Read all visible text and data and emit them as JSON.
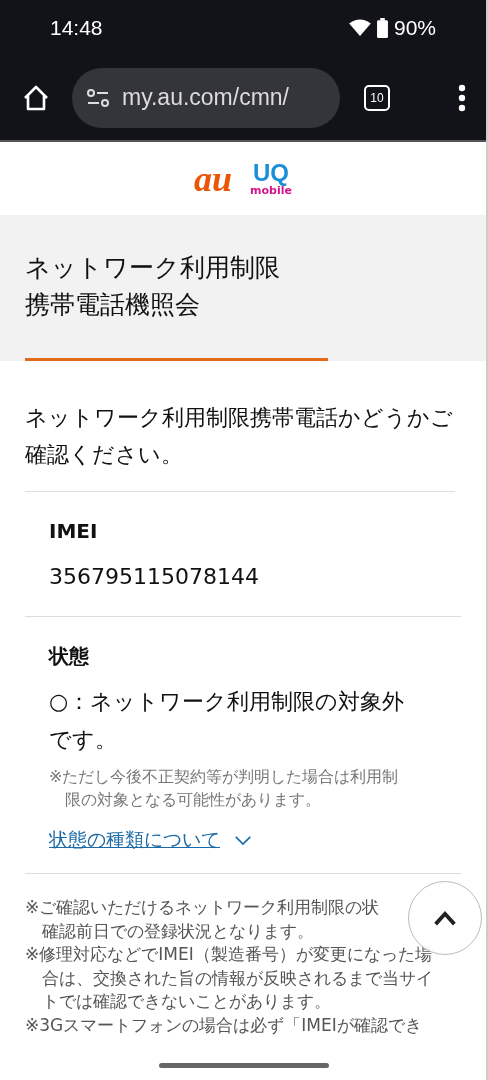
{
  "status_bar": {
    "time": "14:48",
    "battery": "90%"
  },
  "browser": {
    "url": "my.au.com/cmn/",
    "tab_count": "10"
  },
  "header": {
    "logo_primary": "au",
    "logo_secondary_top": "UQ",
    "logo_secondary_bottom": "mobile"
  },
  "page": {
    "title_lines": [
      "ネットワーク利用制限",
      "携帯電話機照会"
    ],
    "intro": "ネットワーク利用制限携帯電話かどうかご確認ください。",
    "fields": [
      {
        "label": "IMEI",
        "value": "356795115078144"
      },
      {
        "label": "状態",
        "value": "○：ネットワーク利用制限の対象外です。",
        "note": "※ただし今後不正契約等が判明した場合は利用制限の対象となる可能性があります。"
      }
    ],
    "link": {
      "label": "状態の種類について",
      "expanded": false
    },
    "notes": [
      {
        "lines": [
          "※ご確認いただけるネットワーク利用制限の状",
          "確認前日での登録状況となります。"
        ]
      },
      {
        "lines": [
          "※修理対応などでIMEI（製造番号）が変更になった場",
          "合は、交換された旨の情報が反映されるまで当サイ",
          "トでは確認できないことがあります。"
        ]
      },
      {
        "lines": [
          "※3Gスマートフォンの場合は必ず「IMEIが確認でき"
        ]
      }
    ]
  }
}
